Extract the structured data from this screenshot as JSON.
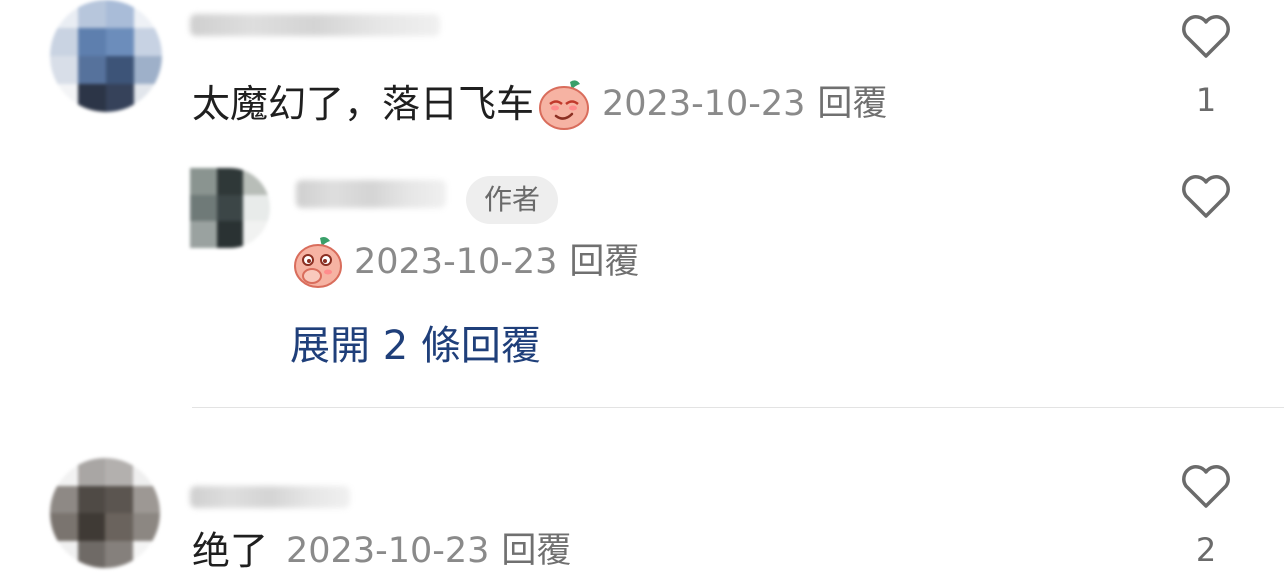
{
  "comments": [
    {
      "text": "太魔幻了，落日飞车",
      "emoji_icon": "peach-smug-emoji",
      "date": "2023-10-23",
      "reply_label": "回覆",
      "likes": "1"
    },
    {
      "author_badge": "作者",
      "emoji_icon": "peach-giggle-emoji",
      "date": "2023-10-23",
      "reply_label": "回覆",
      "expand_label": "展開 2 條回覆"
    },
    {
      "text": "绝了",
      "date": "2023-10-23",
      "reply_label": "回覆",
      "likes": "2"
    }
  ],
  "colors": {
    "expand_link": "#1f3f7a",
    "meta": "#8a8a8a",
    "badge_bg": "#eeeeee"
  }
}
